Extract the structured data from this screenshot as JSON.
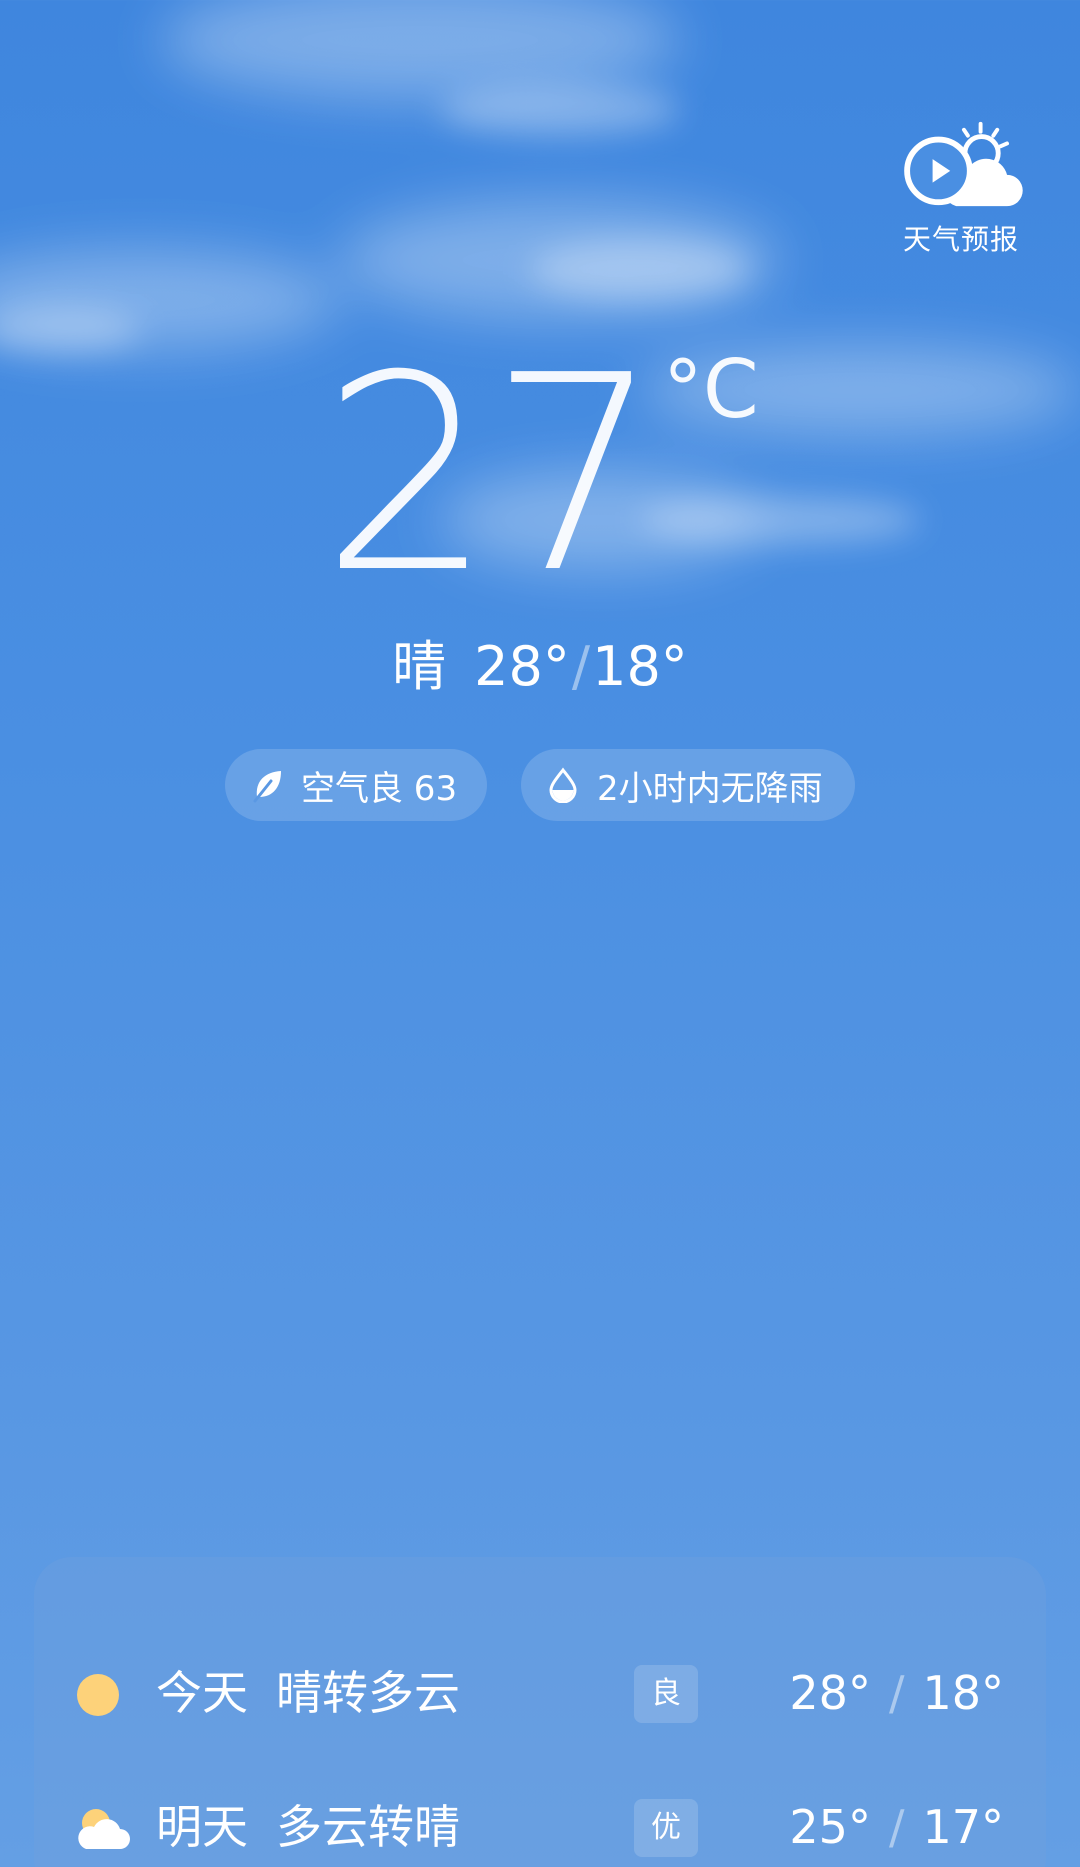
{
  "header": {
    "forecast_button_label": "天气预报",
    "forecast_icon": "play-cloud-sun-icon"
  },
  "current": {
    "temperature": "27",
    "unit": "°C",
    "condition": "晴",
    "high": "28°",
    "low": "18°"
  },
  "chips": [
    {
      "icon": "leaf-icon",
      "text": "空气良 63"
    },
    {
      "icon": "raindrop-icon",
      "text": "2小时内无降雨"
    }
  ],
  "daily": [
    {
      "icon": "sun-icon",
      "day": "今天",
      "condition": "晴转多云",
      "aqi": "良",
      "high": "28°",
      "low": "18°"
    },
    {
      "icon": "partly-cloudy-icon",
      "day": "明天",
      "condition": "多云转晴",
      "aqi": "优",
      "high": "25°",
      "low": "17°"
    }
  ],
  "colors": {
    "sky_top": "#3f86de",
    "sky_bottom": "#649fe4",
    "sun": "#fdd27a"
  }
}
